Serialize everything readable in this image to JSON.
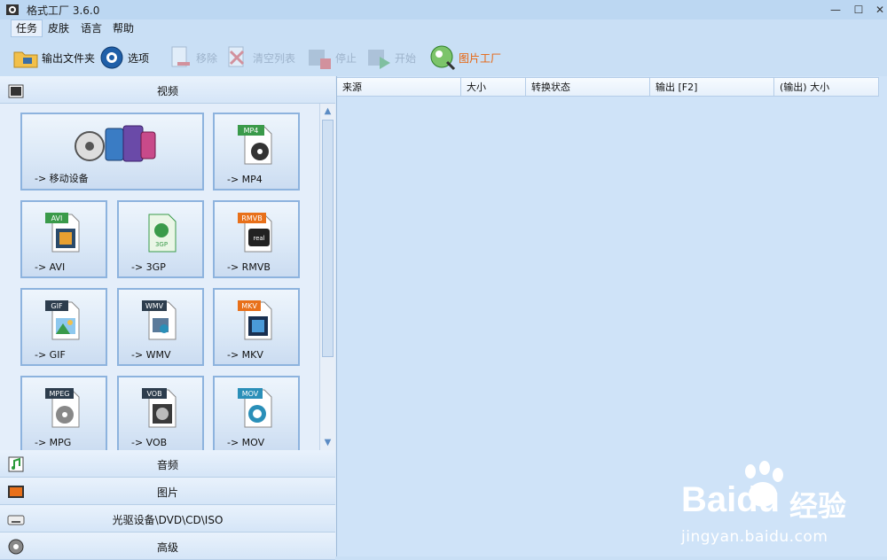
{
  "window": {
    "title": "格式工厂 3.6.0",
    "min": "—",
    "max": "☐",
    "close": "✕"
  },
  "menu": [
    "任务",
    "皮肤",
    "语言",
    "帮助"
  ],
  "toolbar": {
    "output_folder": "输出文件夹",
    "options": "选项",
    "remove": "移除",
    "clear_list": "清空列表",
    "stop": "停止",
    "start": "开始",
    "picture_factory": "图片工厂"
  },
  "categories": {
    "video": "视频",
    "audio": "音频",
    "picture": "图片",
    "optical": "光驱设备\\DVD\\CD\\ISO",
    "advanced": "高级"
  },
  "tiles": {
    "mobile": "-> 移动设备",
    "mp4": "-> MP4",
    "avi": "-> AVI",
    "3gp": "-> 3GP",
    "rmvb": "-> RMVB",
    "gif": "-> GIF",
    "wmv": "-> WMV",
    "mkv": "-> MKV",
    "mpg": "-> MPG",
    "vob": "-> VOB",
    "mov": "-> MOV"
  },
  "badges": {
    "mp4": "MP4",
    "avi": "AVI",
    "rmvb": "RMVB",
    "gif": "GIF",
    "wmv": "WMV",
    "mkv": "MKV",
    "mpeg": "MPEG",
    "vob": "VOB",
    "mov": "MOV",
    "gp": "3GP",
    "real": "real"
  },
  "columns": [
    "来源",
    "大小",
    "转换状态",
    "输出 [F2]",
    "(输出) 大小"
  ],
  "watermark": {
    "brand": "Baidu",
    "cn": "经验",
    "url": "jingyan.baidu.com"
  },
  "colors": {
    "badge_green": "#3a9a4a",
    "badge_orange": "#e8701a",
    "badge_dark": "#2d3d4d",
    "badge_teal": "#2a8fb8",
    "accent": "#e8620a"
  }
}
